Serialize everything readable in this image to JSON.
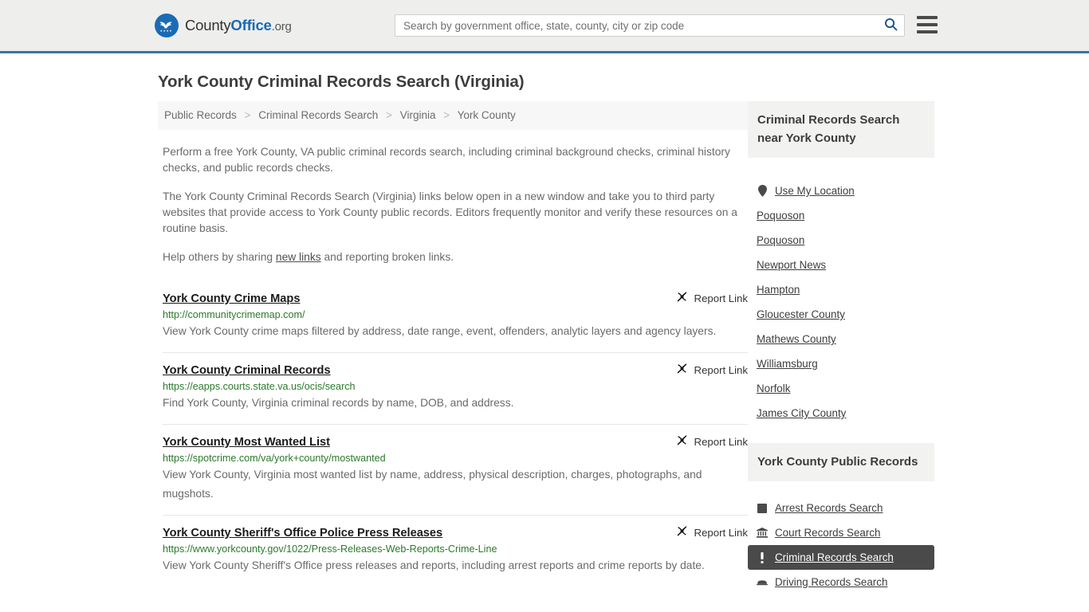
{
  "header": {
    "brand": {
      "name_part1": "County",
      "name_part2": "Office",
      "name_suffix": ".org",
      "logo_icon": "eagle-shield-logo-icon"
    },
    "search": {
      "placeholder": "Search by government office, state, county, city or zip code",
      "value": "",
      "search_icon": "search-icon"
    },
    "menu_icon": "hamburger-menu-icon",
    "accent_color": "#3b72a4"
  },
  "main": {
    "title": "York County Criminal Records Search (Virginia)",
    "breadcrumb": {
      "separator": ">",
      "items": [
        {
          "label": "Public Records"
        },
        {
          "label": "Criminal Records Search"
        },
        {
          "label": "Virginia"
        },
        {
          "label": "York County"
        }
      ]
    },
    "intro": {
      "paragraph1": "Perform a free York County, VA public criminal records search, including criminal background checks, criminal history checks, and public records checks.",
      "paragraph2": "The York County Criminal Records Search (Virginia) links below open in a new window and take you to third party websites that provide access to York County public records. Editors frequently monitor and verify these resources on a routine basis.",
      "paragraph3_before": "Help others by sharing ",
      "paragraph3_link": "new links",
      "paragraph3_after": " and reporting broken links."
    },
    "report_link_label": "Report Link",
    "report_link_icon": "broken-link-icon",
    "links": [
      {
        "title": "York County Crime Maps",
        "url": "http://communitycrimemap.com/",
        "description": "View York County crime maps filtered by address, date range, event, offenders, analytic layers and agency layers."
      },
      {
        "title": "York County Criminal Records",
        "url": "https://eapps.courts.state.va.us/ocis/search",
        "description": "Find York County, Virginia criminal records by name, DOB, and address."
      },
      {
        "title": "York County Most Wanted List",
        "url": "https://spotcrime.com/va/york+county/mostwanted",
        "description": "View York County, Virginia most wanted list by name, address, physical description, charges, photographs, and mugshots."
      },
      {
        "title": "York County Sheriff's Office Police Press Releases",
        "url": "https://www.yorkcounty.gov/1022/Press-Releases-Web-Reports-Crime-Line",
        "description": "View York County Sheriff's Office press releases and reports, including arrest reports and crime reports by date."
      }
    ]
  },
  "sidebar": {
    "nearby": {
      "heading": "Criminal Records Search near York County",
      "items": [
        {
          "label": "Use My Location",
          "icon": "location-pin-icon"
        },
        {
          "label": "Poquoson",
          "icon": null
        },
        {
          "label": "Poquoson",
          "icon": null
        },
        {
          "label": "Newport News",
          "icon": null
        },
        {
          "label": "Hampton",
          "icon": null
        },
        {
          "label": "Gloucester County",
          "icon": null
        },
        {
          "label": "Mathews County",
          "icon": null
        },
        {
          "label": "Williamsburg",
          "icon": null
        },
        {
          "label": "Norfolk",
          "icon": null
        },
        {
          "label": "James City County",
          "icon": null
        }
      ]
    },
    "public_records": {
      "heading": "York County Public Records",
      "items": [
        {
          "label": "Arrest Records Search",
          "icon": "fingerprint-square-icon",
          "active": false
        },
        {
          "label": "Court Records Search",
          "icon": "courthouse-icon",
          "active": false
        },
        {
          "label": "Criminal Records Search",
          "icon": "exclamation-icon",
          "active": true
        },
        {
          "label": "Driving Records Search",
          "icon": "car-icon",
          "active": false
        }
      ]
    }
  }
}
